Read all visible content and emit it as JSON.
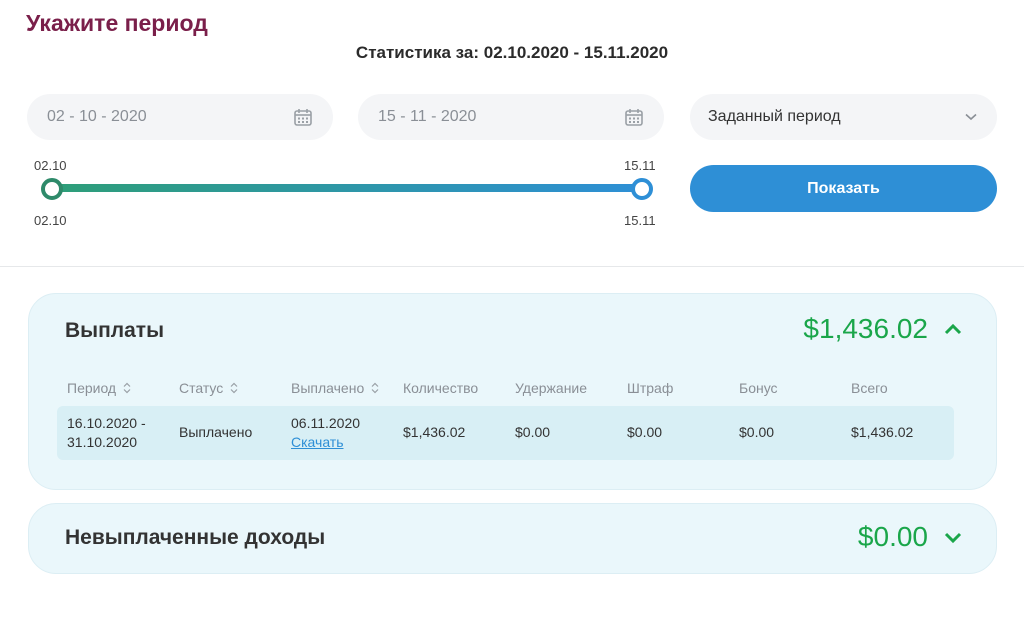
{
  "header": {
    "title": "Укажите период",
    "stats_line": "Статистика за: 02.10.2020 - 15.11.2020"
  },
  "filters": {
    "date_from": "02 - 10 - 2020",
    "date_to": "15 - 11 - 2020",
    "period_select": "Заданный период",
    "show_button": "Показать"
  },
  "slider": {
    "top_left": "02.10",
    "top_right": "15.11",
    "bottom_left": "02.10",
    "bottom_right": "15.11"
  },
  "payouts": {
    "title": "Выплаты",
    "total": "$1,436.02",
    "expanded": true,
    "columns": [
      "Период",
      "Статус",
      "Выплачено",
      "Количество",
      "Удержание",
      "Штраф",
      "Бонус",
      "Всего"
    ],
    "rows": [
      {
        "period_line1": "16.10.2020 -",
        "period_line2": "31.10.2020",
        "status": "Выплачено",
        "paid_date": "06.11.2020",
        "download": "Скачать",
        "amount": "$1,436.02",
        "withholding": "$0.00",
        "penalty": "$0.00",
        "bonus": "$0.00",
        "total": "$1,436.02"
      }
    ]
  },
  "unpaid": {
    "title": "Невыплаченные доходы",
    "total": "$0.00",
    "expanded": false
  },
  "colors": {
    "heading": "#7a1f4a",
    "accent_blue": "#2e8fd6",
    "accent_green": "#1aa64a",
    "card_bg": "#eaf7fb"
  }
}
